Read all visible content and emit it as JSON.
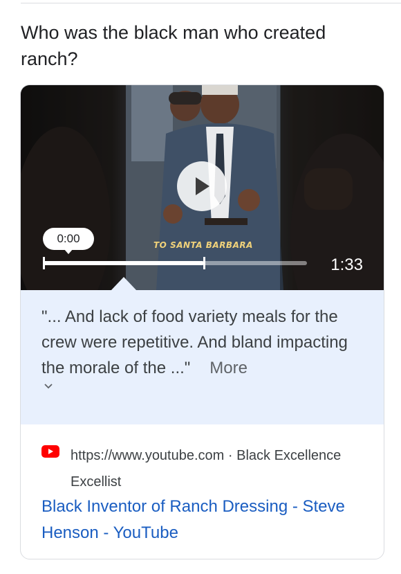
{
  "question": "Who was the black man who created ranch?",
  "video": {
    "caption": "TO SANTA BARBARA",
    "current_time": "0:00",
    "duration": "1:33",
    "progress_fraction": 0.61
  },
  "transcript": {
    "text": "\"... And lack of food variety meals for the crew were repetitive. And bland impacting the morale of the ...\"",
    "more_label": "More"
  },
  "source": {
    "url": "https://www.youtube.com",
    "separator": " · ",
    "channel": "Black Excellence Excellist"
  },
  "result_title": "Black Inventor of Ranch Dressing - Steve Henson - YouTube",
  "colors": {
    "link": "#1a5dc1",
    "transcript_bg": "#e8f0fd",
    "youtube_red": "#ff0000"
  },
  "icons": {
    "play": "play-icon",
    "chevron": "chevron-down-icon",
    "source": "youtube-icon"
  }
}
